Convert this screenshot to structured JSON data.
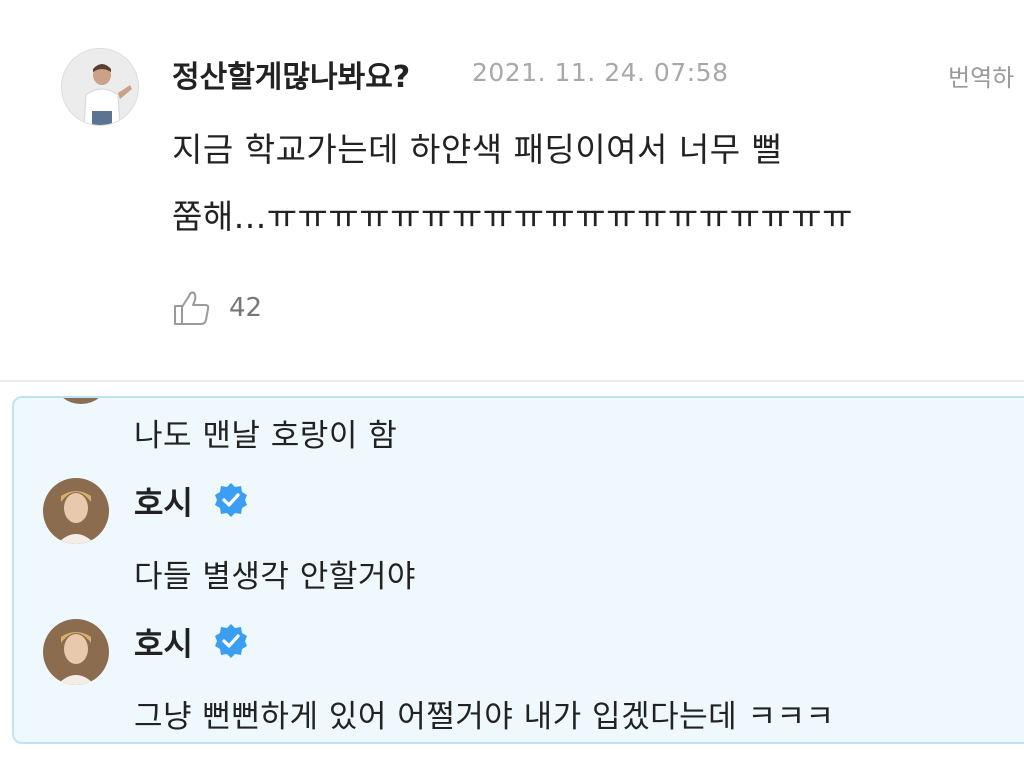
{
  "comment": {
    "author": "정산할게많나봐요?",
    "timestamp": "2021. 11. 24. 07:58",
    "translate_label": "번역하",
    "body_lines": [
      "지금 학교가는데 하얀색 패딩이여서 너무 뻘",
      "쭘해...ㅠㅠㅠㅠㅠㅠㅠㅠㅠㅠㅠㅠㅠㅠㅠㅠㅠㅠㅠ"
    ],
    "like_count": "42",
    "like_icon": "thumbs-up-outline-icon"
  },
  "thread": {
    "background_color": "#eef8fd",
    "border_color": "#bfe3f3",
    "first_text": "나도 맨날 호랑이 함",
    "replies": [
      {
        "name": "호시",
        "verified": true,
        "text": "다들 별생각 안할거야"
      },
      {
        "name": "호시",
        "verified": true,
        "text": "그냥 뻔뻔하게 있어 어쩔거야 내가 입겠다는데 ㅋㅋㅋ"
      }
    ]
  },
  "colors": {
    "verified_badge": "#3a9ff2",
    "timestamp": "#a8a8a8",
    "like_count": "#777777"
  }
}
